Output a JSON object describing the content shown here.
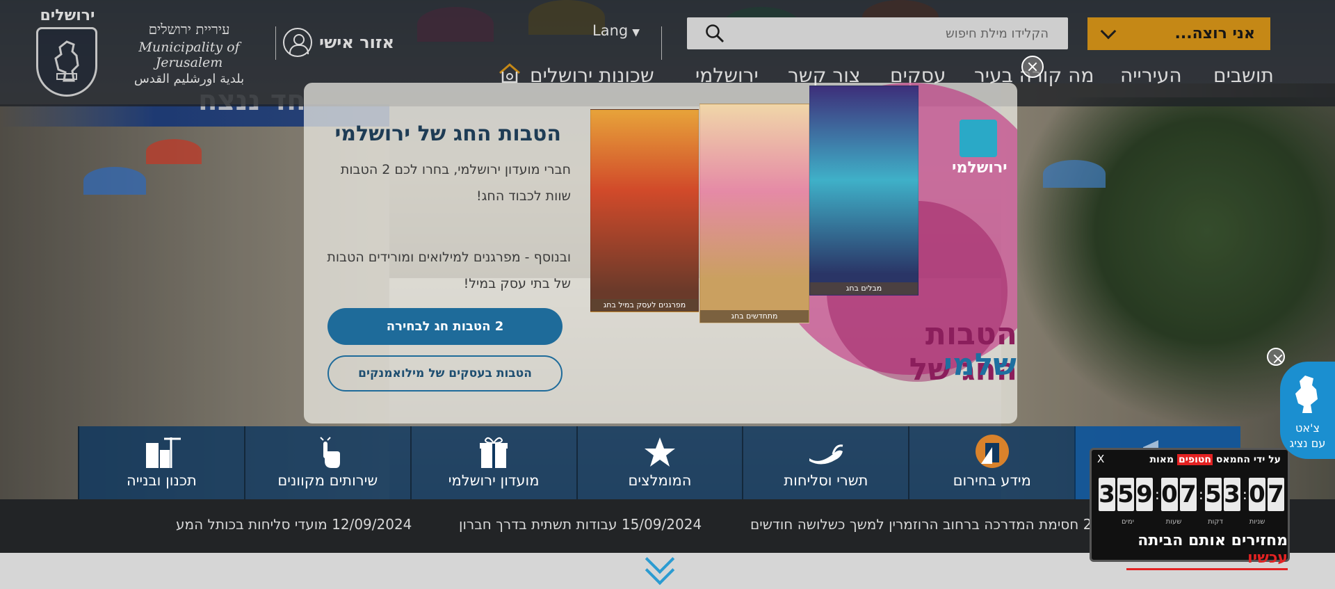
{
  "header": {
    "logo_title": "ירושלים",
    "municipality_he": "עיריית ירושלים",
    "municipality_en": "Municipality of Jerusalem",
    "municipality_ar": "بلدية اورشليم القدس",
    "personal_area": "אזור אישי",
    "lang": "Lang",
    "search_placeholder": "הקלידו מילת חיפוש",
    "want_button": "אני רוצה...",
    "banner_fragment": "חד ננצח"
  },
  "nav": [
    {
      "label": "תושבים"
    },
    {
      "label": "העירייה"
    },
    {
      "label": "מה קורה בעיר"
    },
    {
      "label": "עסקים"
    },
    {
      "label": "צור קשר"
    },
    {
      "label": "ירושלמי"
    },
    {
      "label": "שכונות ירושלים"
    }
  ],
  "modal": {
    "title": "הטבות החג של ירושלמי",
    "para1": "חברי מועדון ירושלמי, בחרו לכם 2 הטבות שוות לכבוד החג!",
    "para2": "ובנוסף - מפרגנים למילואים ומורידים הטבות של בתי עסק במיל!",
    "btn_primary": "2 הטבות חג לבחירה",
    "btn_secondary": "הטבות בעסקים של מילואמנקים",
    "brand": "ירושלמי",
    "image_title_1": "הטבות החג של",
    "image_title_2": "ירושלמי",
    "poster_captions": [
      "מפרגנים לעסק במיל בחג",
      "מתחדשים בחג",
      "מבלים בחג"
    ]
  },
  "quick_links": [
    {
      "label": "תכנון ובנייה",
      "icon": "buildings-icon"
    },
    {
      "label": "שירותים מקוונים",
      "icon": "touch-hand-icon"
    },
    {
      "label": "מועדון ירושלמי",
      "icon": "gift-icon"
    },
    {
      "label": "המומלצים",
      "icon": "star-icon"
    },
    {
      "label": "תשרי וסליחות",
      "icon": "shofar-icon"
    },
    {
      "label": "מידע בחירום",
      "icon": "emergency-icon"
    },
    {
      "label": "",
      "icon": "megaphone-icon"
    }
  ],
  "news": [
    "12/09/2024 מועדי סליחות בכותל המע",
    "15/09/2024 עבודות תשתית בדרך חברון",
    "25 חסימת המדרכה ברחוב הרוזמרין למשך כשלושה חודשים"
  ],
  "countdown": {
    "close": "X",
    "header_pre": "מאות",
    "header_highlight": "חטופים",
    "header_post": "על ידי החמאס",
    "digits": [
      "3",
      "5",
      "9",
      "0",
      "7",
      "5",
      "3",
      "0",
      "7"
    ],
    "units": [
      "ימים",
      "שעות",
      "דקות",
      "שניות"
    ],
    "bottom_text": "מחזירים אותם הביתה",
    "bottom_red": "עכשיו"
  },
  "chat": {
    "line1": "צ'אט",
    "line2": "עם נציג"
  },
  "colors": {
    "accent_orange": "#e8a01b",
    "primary_blue": "#1e6b9a",
    "header_dark": "#23262d",
    "countdown_red": "#e32222"
  }
}
